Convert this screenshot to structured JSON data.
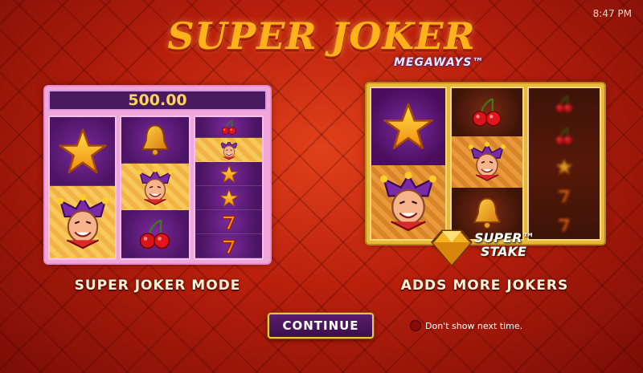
{
  "status_bar": {
    "time": "8:47 PM"
  },
  "logo": {
    "title": "SUPER JOKER",
    "subtitle": "MEGAWAYS™"
  },
  "left_panel": {
    "win_amount": "500.00",
    "caption": "SUPER JOKER MODE",
    "reels": [
      [
        "star",
        "joker"
      ],
      [
        "bell",
        "joker",
        "cherry"
      ],
      [
        "cherry",
        "joker",
        "star",
        "star",
        "seven",
        "seven"
      ]
    ]
  },
  "right_panel": {
    "caption": "ADDS MORE JOKERS",
    "feature_badge": {
      "line1": "SUPER™",
      "line2": "STAKE"
    },
    "reels": [
      [
        "star",
        "joker"
      ],
      [
        "cherry",
        "joker",
        "bell"
      ],
      [
        "spinning"
      ]
    ]
  },
  "continue_button": {
    "label": "CONTINUE"
  },
  "dont_show": {
    "label": "Don't show next time."
  },
  "colors": {
    "background": "#b81f0c",
    "accent_gold": "#ffb21a",
    "button_purple": "#4a1460"
  }
}
